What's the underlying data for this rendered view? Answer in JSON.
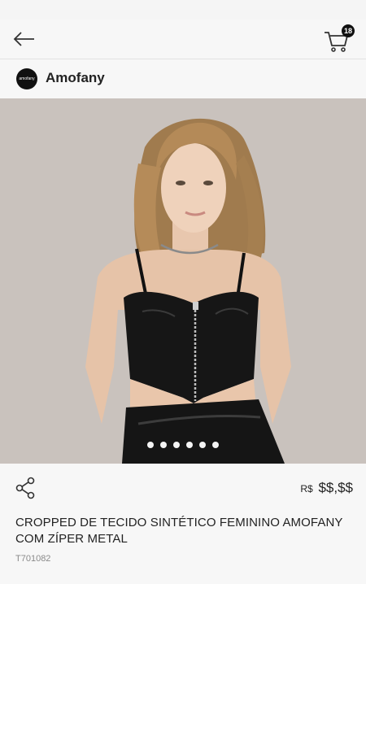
{
  "header": {
    "back_icon": "arrow-left-icon",
    "cart_icon": "shopping-cart-icon",
    "cart_count": "18"
  },
  "brand": {
    "name": "Amofany",
    "logo_text": "amofany"
  },
  "product": {
    "image_description_icon": "product-photo",
    "carousel_pages": 6,
    "carousel_active_index": 0,
    "price_currency": "R$",
    "price_value": "$$,$$",
    "title": "CROPPED DE TECIDO SINTÉTICO FEMININO AMOFANY COM ZÍPER METAL",
    "sku": "T701082"
  },
  "colors": {
    "background": "#ffffff",
    "bar": "#f7f7f7",
    "accent": "#111111"
  }
}
